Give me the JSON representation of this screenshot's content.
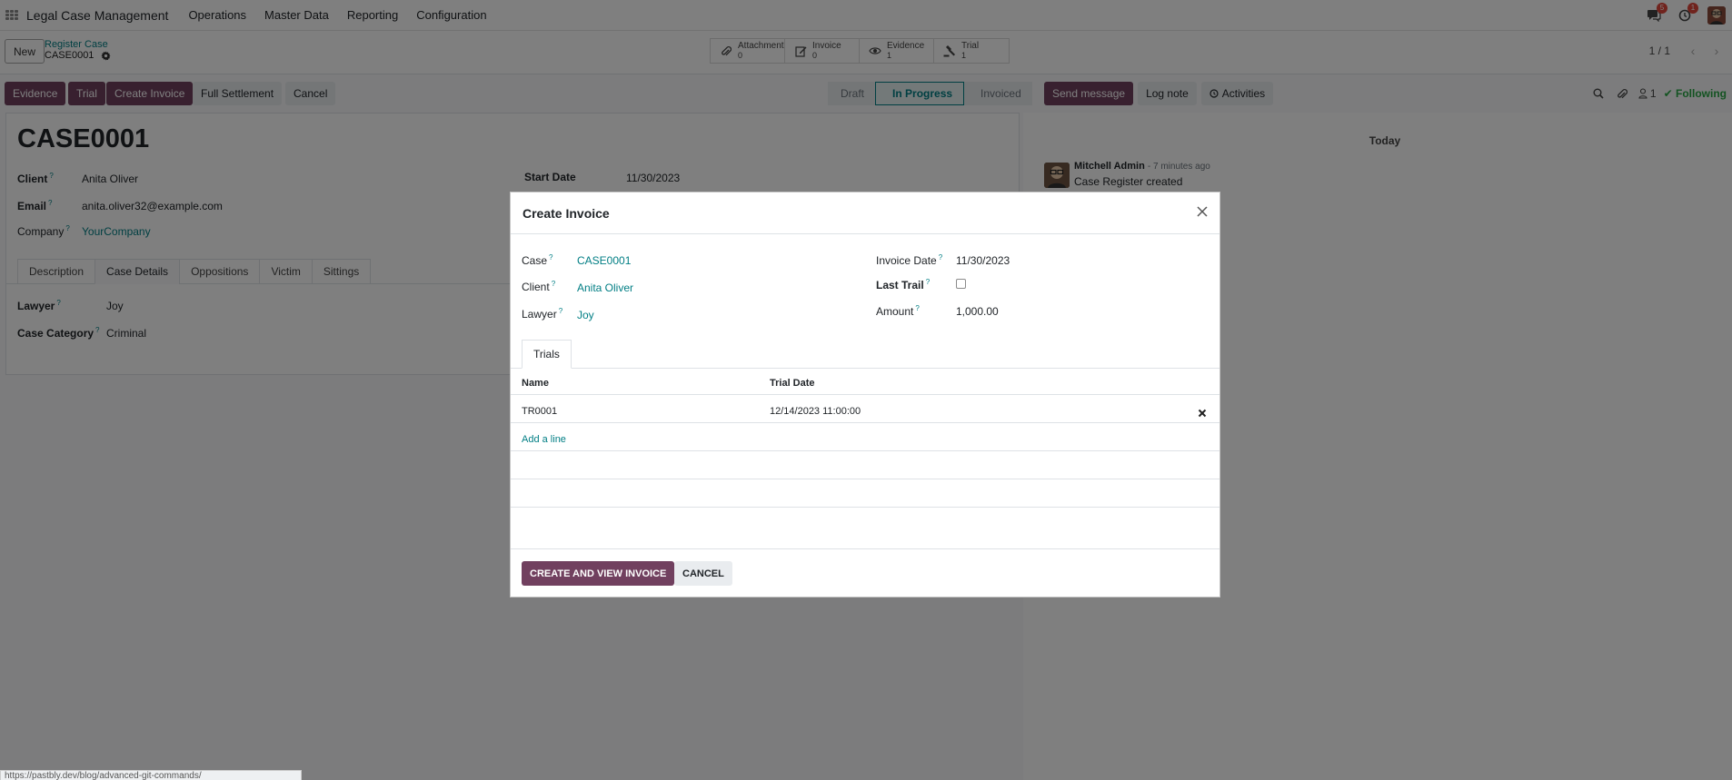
{
  "navbar": {
    "brand": "Legal Case Management",
    "menu": [
      "Operations",
      "Master Data",
      "Reporting",
      "Configuration"
    ],
    "messages_badge": "5",
    "activities_badge": "1"
  },
  "control_panel": {
    "new_label": "New",
    "breadcrumb_parent": "Register Case",
    "breadcrumb_current": "CASE0001",
    "smart_buttons": [
      {
        "label": "Attachment",
        "count": "0",
        "icon": "paperclip-icon"
      },
      {
        "label": "Invoice",
        "count": "0",
        "icon": "edit-icon"
      },
      {
        "label": "Evidence",
        "count": "1",
        "icon": "eye-icon"
      },
      {
        "label": "Trial",
        "count": "1",
        "icon": "gavel-icon"
      }
    ],
    "pager": "1 / 1"
  },
  "action_bar": {
    "buttons": [
      "Evidence",
      "Trial",
      "Create Invoice",
      "Full Settlement",
      "Cancel"
    ],
    "stages": [
      "Draft",
      "In Progress",
      "Invoiced"
    ],
    "active_stage": "In Progress",
    "chatter_buttons": [
      "Send message",
      "Log note",
      "Activities"
    ],
    "followers_count": "1",
    "following_label": "Following"
  },
  "form": {
    "title": "CASE0001",
    "client_label": "Client",
    "client": "Anita Oliver",
    "email_label": "Email",
    "email": "anita.oliver32@example.com",
    "company_label": "Company",
    "company": "YourCompany",
    "start_date_label": "Start Date",
    "start_date": "11/30/2023",
    "tabs": [
      "Description",
      "Case Details",
      "Oppositions",
      "Victim",
      "Sittings"
    ],
    "active_tab": "Case Details",
    "lawyer_label": "Lawyer",
    "lawyer": "Joy",
    "case_category_label": "Case Category",
    "case_category": "Criminal"
  },
  "chatter": {
    "today_label": "Today",
    "author": "Mitchell Admin",
    "time": "- 7 minutes ago",
    "body": "Case Register created"
  },
  "modal": {
    "title": "Create Invoice",
    "case_label": "Case",
    "case": "CASE0001",
    "client_label": "Client",
    "client": "Anita Oliver",
    "lawyer_label": "Lawyer",
    "lawyer": "Joy",
    "invoice_date_label": "Invoice Date",
    "invoice_date": "11/30/2023",
    "last_trail_label": "Last Trail",
    "amount_label": "Amount",
    "amount": "1,000.00",
    "tab_label": "Trials",
    "columns": [
      "Name",
      "Trial Date"
    ],
    "rows": [
      {
        "name": "TR0001",
        "trial_date": "12/14/2023 11:00:00"
      }
    ],
    "add_line": "Add a line",
    "create_button": "CREATE AND VIEW INVOICE",
    "cancel_button": "CANCEL"
  },
  "status_url": "https://pastbly.dev/blog/advanced-git-commands/",
  "colors": {
    "primary": "#71405f",
    "link": "#017e84",
    "following": "#28a745"
  }
}
